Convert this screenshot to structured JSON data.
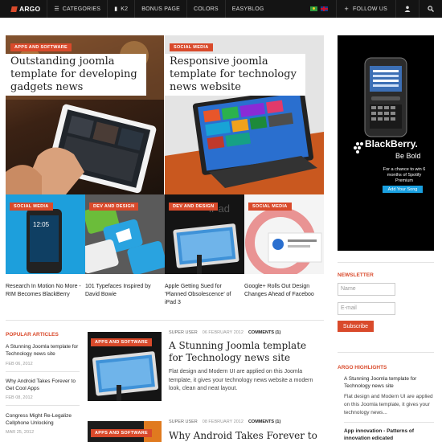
{
  "nav": {
    "logo": "ARGO",
    "items": [
      {
        "label": "CATEGORIES",
        "icon": "list-icon"
      },
      {
        "label": "K2",
        "icon": "bookmark-icon"
      },
      {
        "label": "BONUS PAGE",
        "icon": ""
      },
      {
        "label": "COLORS",
        "icon": ""
      },
      {
        "label": "EASYBLOG",
        "icon": ""
      }
    ],
    "follow": "FOLLOW US"
  },
  "hero": [
    {
      "tag": "APPS AND SOFTWARE",
      "title": "Outstanding joomla template for developing gadgets news"
    },
    {
      "tag": "SOCIAL MEDIA",
      "title": "Responsive joomla template for technology news website"
    }
  ],
  "tiles": [
    {
      "tag": "SOCIAL MEDIA",
      "caption": "Research In Motion No More - RIM Becomes BlackBerry"
    },
    {
      "tag": "DEV AND DESIGN",
      "caption": "101 Typefaces Inspired by David Bowie"
    },
    {
      "tag": "DEV AND DESIGN",
      "caption": "Apple Getting Sued for 'Planned Obsolescence' of iPad 3"
    },
    {
      "tag": "SOCIAL MEDIA",
      "caption": "Google+ Rolls Out Design Changes Ahead of Faceboo"
    }
  ],
  "popular": {
    "heading": "POPULAR ARTICLES",
    "items": [
      {
        "title": "A Stunning Joomla template for Technology news site",
        "date": "FEB 06, 2012"
      },
      {
        "title": "Why Android Takes Forever to Get Cool Apps",
        "date": "FEB 08, 2012"
      },
      {
        "title": "Congress Might Re-Legalize Cellphone Unlocking",
        "date": "MAR 25, 2012"
      }
    ]
  },
  "articles": [
    {
      "tag": "APPS AND SOFTWARE",
      "author": "SUPER USER",
      "date": "06 FEBRUARY 2012",
      "comments": "COMMENTS (1)",
      "title": "A Stunning Joomla template for Technology news site",
      "text": "Flat design and Modern UI are applied on this Joomla template, it gives your technology news website a modern look, clean and neat layout."
    },
    {
      "tag": "APPS AND SOFTWARE",
      "author": "SUPER USER",
      "date": "08 FEBRUARY 2012",
      "comments": "COMMENTS (1)",
      "title": "Why Android Takes Forever to",
      "text": ""
    }
  ],
  "ad": {
    "brand": "BlackBerry.",
    "slogan": "Be Bold",
    "promo": "For a chance to win 6 months of Spotify Premium",
    "button": "Add Your Song"
  },
  "newsletter": {
    "heading": "NEWSLETTER",
    "name_placeholder": "Name",
    "email_placeholder": "E-mail",
    "subscribe": "Subscribe"
  },
  "highlights": {
    "heading": "ARGO HIGHLIGHTS",
    "items": [
      {
        "title": "A Stunning Joomla template for Technology news site",
        "text": "Flat design and Modern UI are applied on this Joomla template, it gives your technology news..."
      },
      {
        "title": "App innovation - Patterns of innovation edicated",
        "text": ""
      }
    ]
  },
  "colors": {
    "accent": "#d94a2b",
    "topbar": "#141414"
  }
}
